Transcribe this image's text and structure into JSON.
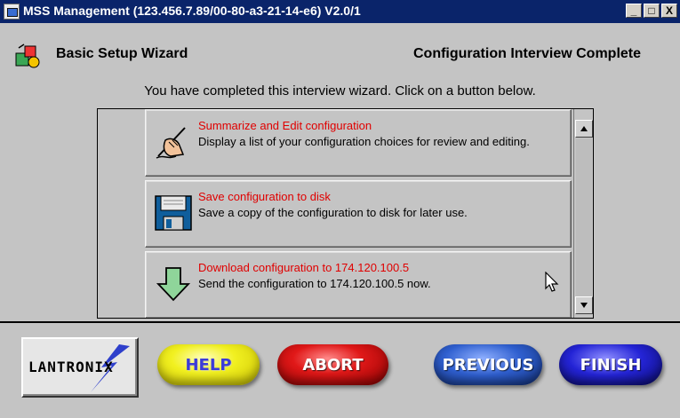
{
  "window": {
    "title": "MSS Management (123.456.7.89/00-80-a3-21-14-e6) V2.0/1",
    "controls": {
      "minimize": "_",
      "maximize": "□",
      "close": "X"
    }
  },
  "header": {
    "wizard_title": "Basic Setup Wizard",
    "status": "Configuration Interview Complete"
  },
  "instructions": "You have completed this interview wizard. Click on a button below.",
  "options": [
    {
      "label": "Summarize and Edit configuration",
      "description": "Display a list of your configuration choices for review and editing.",
      "icon": "hand-writing-icon"
    },
    {
      "label": "Save configuration to disk",
      "description": "Save a copy of the configuration to disk for later use.",
      "icon": "floppy-disk-icon"
    },
    {
      "label": "Download configuration to 174.120.100.5",
      "description": "Send the configuration to 174.120.100.5 now.",
      "icon": "down-arrow-icon"
    }
  ],
  "footer": {
    "logo_text": "LANTRONIX",
    "buttons": {
      "help": "HELP",
      "abort": "ABORT",
      "previous": "PREVIOUS",
      "finish": "FINISH"
    }
  },
  "colors": {
    "titlebar": "#0a246a",
    "background": "#c4c4c4",
    "option_label": "#e00000"
  }
}
